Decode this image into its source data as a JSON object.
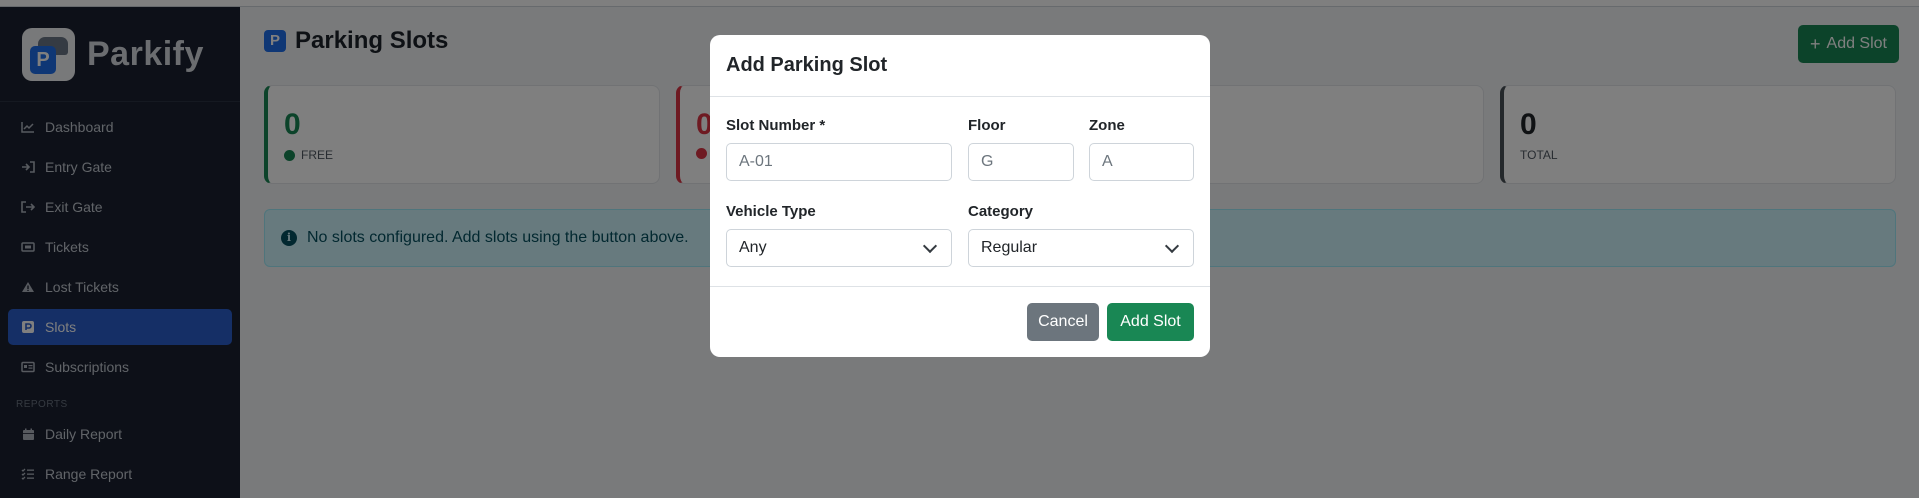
{
  "app": {
    "name": "Parkify"
  },
  "sidebar": {
    "items": [
      {
        "label": "Dashboard",
        "icon": "chart-line-icon"
      },
      {
        "label": "Entry Gate",
        "icon": "sign-in-icon"
      },
      {
        "label": "Exit Gate",
        "icon": "sign-out-icon"
      },
      {
        "label": "Tickets",
        "icon": "ticket-icon"
      },
      {
        "label": "Lost Tickets",
        "icon": "warning-icon"
      },
      {
        "label": "Slots",
        "icon": "parking-icon",
        "active": true
      },
      {
        "label": "Subscriptions",
        "icon": "id-card-icon"
      }
    ],
    "section_reports": "REPORTS",
    "report_items": [
      {
        "label": "Daily Report",
        "icon": "calendar-icon"
      },
      {
        "label": "Range Report",
        "icon": "list-icon"
      }
    ]
  },
  "main": {
    "title": "Parking Slots",
    "add_button": "Add Slot",
    "stats": [
      {
        "value": "0",
        "label": "FREE",
        "color": "#198754"
      },
      {
        "value": "0",
        "label": "",
        "color": "#dc3545"
      },
      {
        "value": "0",
        "label": "TOTAL",
        "color": "#495057"
      }
    ],
    "alert": "No slots configured. Add slots using the button above."
  },
  "modal": {
    "title": "Add Parking Slot",
    "slot_number_label": "Slot Number *",
    "slot_number_placeholder": "A-01",
    "floor_label": "Floor",
    "floor_placeholder": "G",
    "zone_label": "Zone",
    "zone_placeholder": "A",
    "vehicle_type_label": "Vehicle Type",
    "vehicle_type_value": "Any",
    "category_label": "Category",
    "category_value": "Regular",
    "cancel_label": "Cancel",
    "submit_label": "Add Slot"
  },
  "colors": {
    "sidebar_bg": "#1a2130",
    "active_nav": "#2a5ecc",
    "primary_green": "#198754",
    "info_bg": "#cff4fc"
  }
}
